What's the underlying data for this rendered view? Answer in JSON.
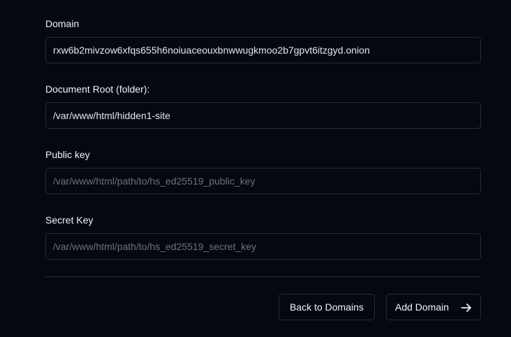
{
  "form": {
    "domain": {
      "label": "Domain",
      "value": "rxw6b2mivzow6xfqs655h6noiuaceouxbnwwugkmoo2b7gpvt6itzgyd.onion",
      "placeholder": ""
    },
    "document_root": {
      "label": "Document Root (folder):",
      "value": "/var/www/html/hidden1-site",
      "placeholder": ""
    },
    "public_key": {
      "label": "Public key",
      "value": "",
      "placeholder": "/var/www/html/path/to/hs_ed25519_public_key"
    },
    "secret_key": {
      "label": "Secret Key",
      "value": "",
      "placeholder": "/var/www/html/path/to/hs_ed25519_secret_key"
    }
  },
  "actions": {
    "back_label": "Back to Domains",
    "add_label": "Add Domain",
    "add_icon": "arrow-right-icon"
  }
}
